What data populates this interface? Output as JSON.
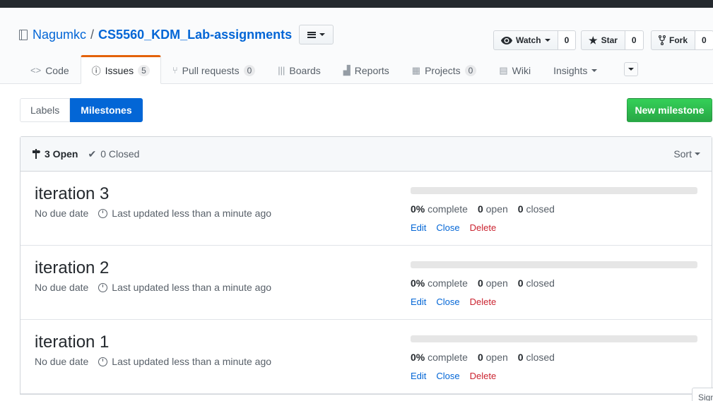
{
  "repo": {
    "owner": "Nagumkc",
    "separator": "/",
    "name": "CS5560_KDM_Lab-assignments"
  },
  "social": {
    "watch": {
      "label": "Watch",
      "count": "0"
    },
    "star": {
      "label": "Star",
      "count": "0"
    },
    "fork": {
      "label": "Fork",
      "count": "0"
    }
  },
  "nav": {
    "code": "Code",
    "issues": "Issues",
    "issues_count": "5",
    "pulls": "Pull requests",
    "pulls_count": "0",
    "boards": "Boards",
    "reports": "Reports",
    "projects": "Projects",
    "projects_count": "0",
    "wiki": "Wiki",
    "insights": "Insights"
  },
  "subnav": {
    "labels": "Labels",
    "milestones": "Milestones"
  },
  "new_milestone": "New milestone",
  "filter": {
    "open": "3 Open",
    "closed": "0 Closed",
    "sort": "Sort"
  },
  "milestones": [
    {
      "title": "iteration 3",
      "due": "No due date",
      "updated": "Last updated less than a minute ago",
      "percent": "0%",
      "percent_label": "complete",
      "open": "0",
      "open_label": "open",
      "closed": "0",
      "closed_label": "closed",
      "progress": 0
    },
    {
      "title": "iteration 2",
      "due": "No due date",
      "updated": "Last updated less than a minute ago",
      "percent": "0%",
      "percent_label": "complete",
      "open": "0",
      "open_label": "open",
      "closed": "0",
      "closed_label": "closed",
      "progress": 0
    },
    {
      "title": "iteration 1",
      "due": "No due date",
      "updated": "Last updated less than a minute ago",
      "percent": "0%",
      "percent_label": "complete",
      "open": "0",
      "open_label": "open",
      "closed": "0",
      "closed_label": "closed",
      "progress": 0
    }
  ],
  "actions": {
    "edit": "Edit",
    "close": "Close",
    "delete": "Delete"
  },
  "signin": "Sign",
  "colors": {
    "accent": "#0366d6",
    "tab_active": "#e36209",
    "success": "#28a745",
    "danger": "#cb2431"
  }
}
